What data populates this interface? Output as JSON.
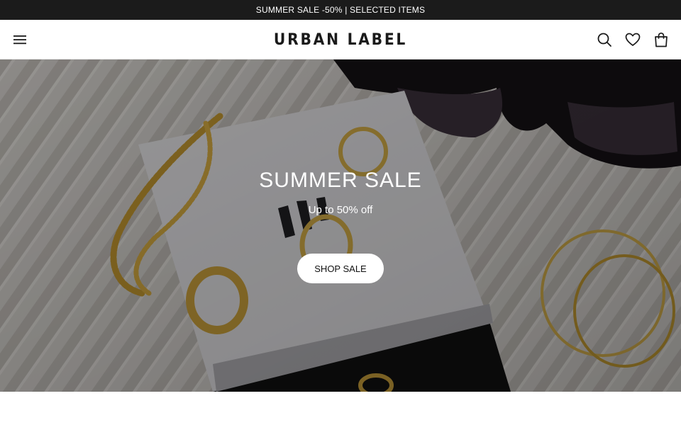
{
  "announcement": {
    "text": "SUMMER SALE -50% | SELECTED ITEMS"
  },
  "header": {
    "logo": "URBAN LABEL",
    "icons": [
      "menu-icon",
      "search-icon",
      "heart-icon",
      "bag-icon"
    ]
  },
  "hero": {
    "title": "SUMMER SALE",
    "subtitle": "Up to 50% off",
    "button_label": "SHOP SALE"
  },
  "colors": {
    "announcement_bg": "#1b1b1b",
    "text_dark": "#1a1a1a",
    "button_bg": "#ffffff"
  }
}
